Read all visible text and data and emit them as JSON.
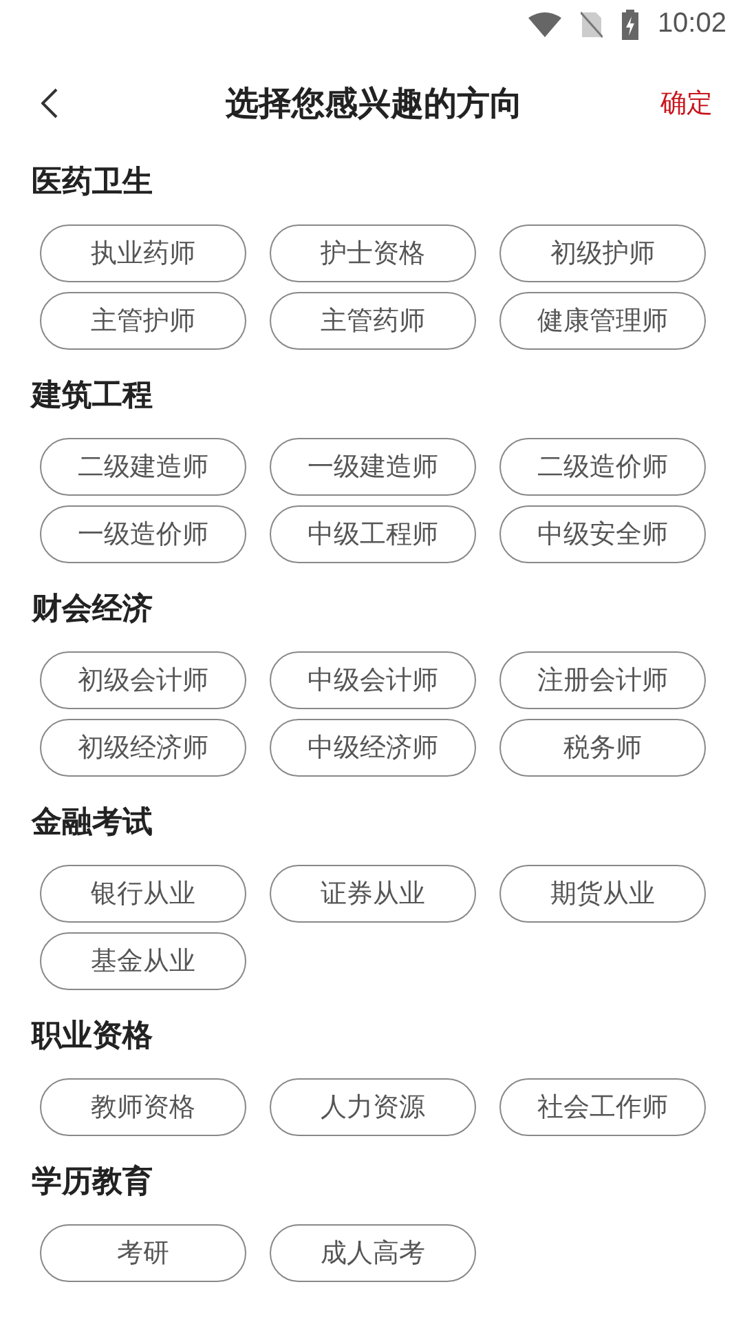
{
  "status_bar": {
    "time": "10:02"
  },
  "header": {
    "title": "选择您感兴趣的方向",
    "confirm": "确定"
  },
  "sections": [
    {
      "title": "医药卫生",
      "tags": [
        "执业药师",
        "护士资格",
        "初级护师",
        "主管护师",
        "主管药师",
        "健康管理师"
      ]
    },
    {
      "title": "建筑工程",
      "tags": [
        "二级建造师",
        "一级建造师",
        "二级造价师",
        "一级造价师",
        "中级工程师",
        "中级安全师"
      ]
    },
    {
      "title": "财会经济",
      "tags": [
        "初级会计师",
        "中级会计师",
        "注册会计师",
        "初级经济师",
        "中级经济师",
        "税务师"
      ]
    },
    {
      "title": "金融考试",
      "tags": [
        "银行从业",
        "证券从业",
        "期货从业",
        "基金从业"
      ]
    },
    {
      "title": "职业资格",
      "tags": [
        "教师资格",
        "人力资源",
        "社会工作师"
      ]
    },
    {
      "title": "学历教育",
      "tags": [
        "考研",
        "成人高考"
      ]
    }
  ]
}
